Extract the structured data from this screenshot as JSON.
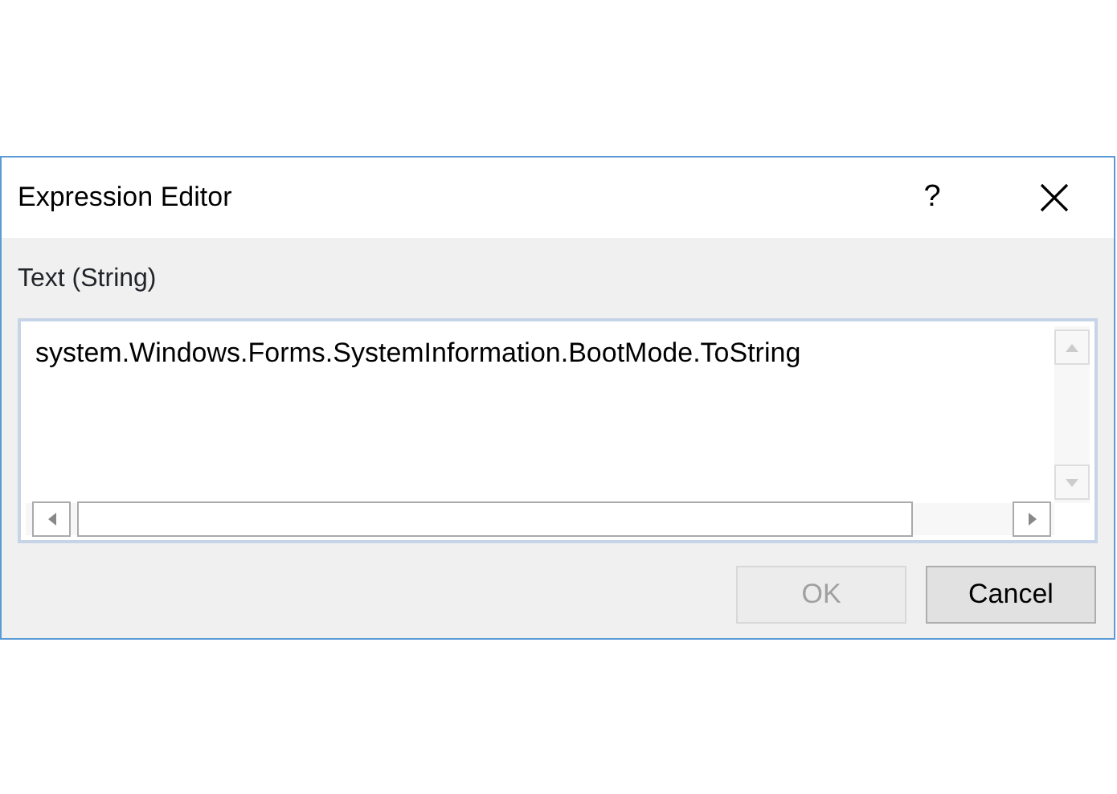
{
  "window": {
    "title": "Expression Editor",
    "help": "?"
  },
  "field": {
    "label": "Text (String)",
    "value": "system.Windows.Forms.SystemInformation.BootMode.ToString"
  },
  "buttons": [
    {
      "label": "OK",
      "disabled": true
    },
    {
      "label": "Cancel",
      "disabled": false
    }
  ]
}
